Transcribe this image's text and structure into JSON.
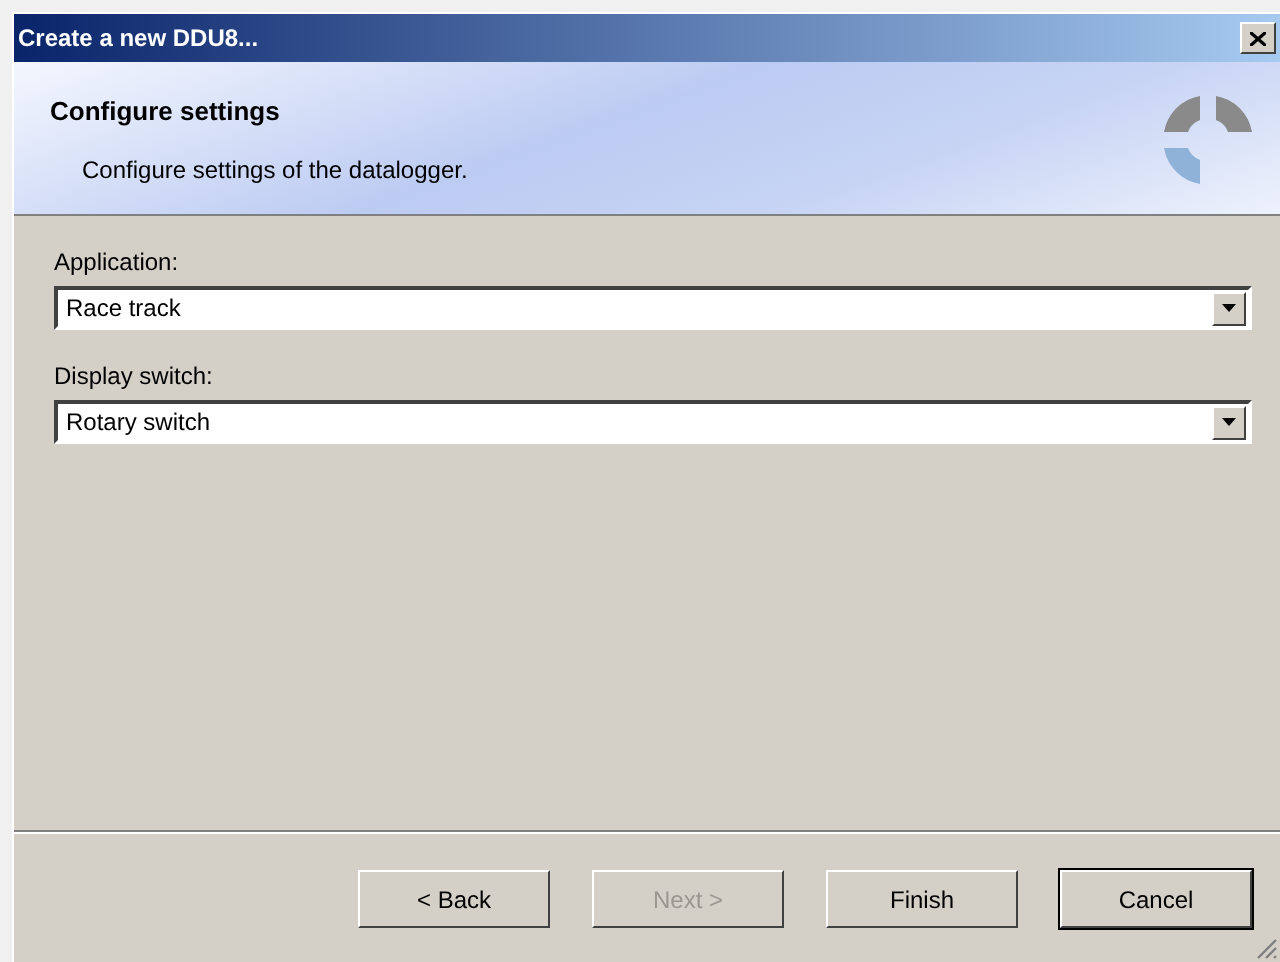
{
  "window": {
    "title": "Create a new DDU8..."
  },
  "header": {
    "title": "Configure settings",
    "subtitle": "Configure settings of the datalogger."
  },
  "fields": [
    {
      "label": "Application:",
      "value": "Race track"
    },
    {
      "label": "Display switch:",
      "value": "Rotary switch"
    }
  ],
  "buttons": [
    {
      "label": "< Back",
      "disabled": false,
      "default": false
    },
    {
      "label": "Next >",
      "disabled": true,
      "default": false
    },
    {
      "label": "Finish",
      "disabled": false,
      "default": false
    },
    {
      "label": "Cancel",
      "disabled": false,
      "default": true
    }
  ]
}
